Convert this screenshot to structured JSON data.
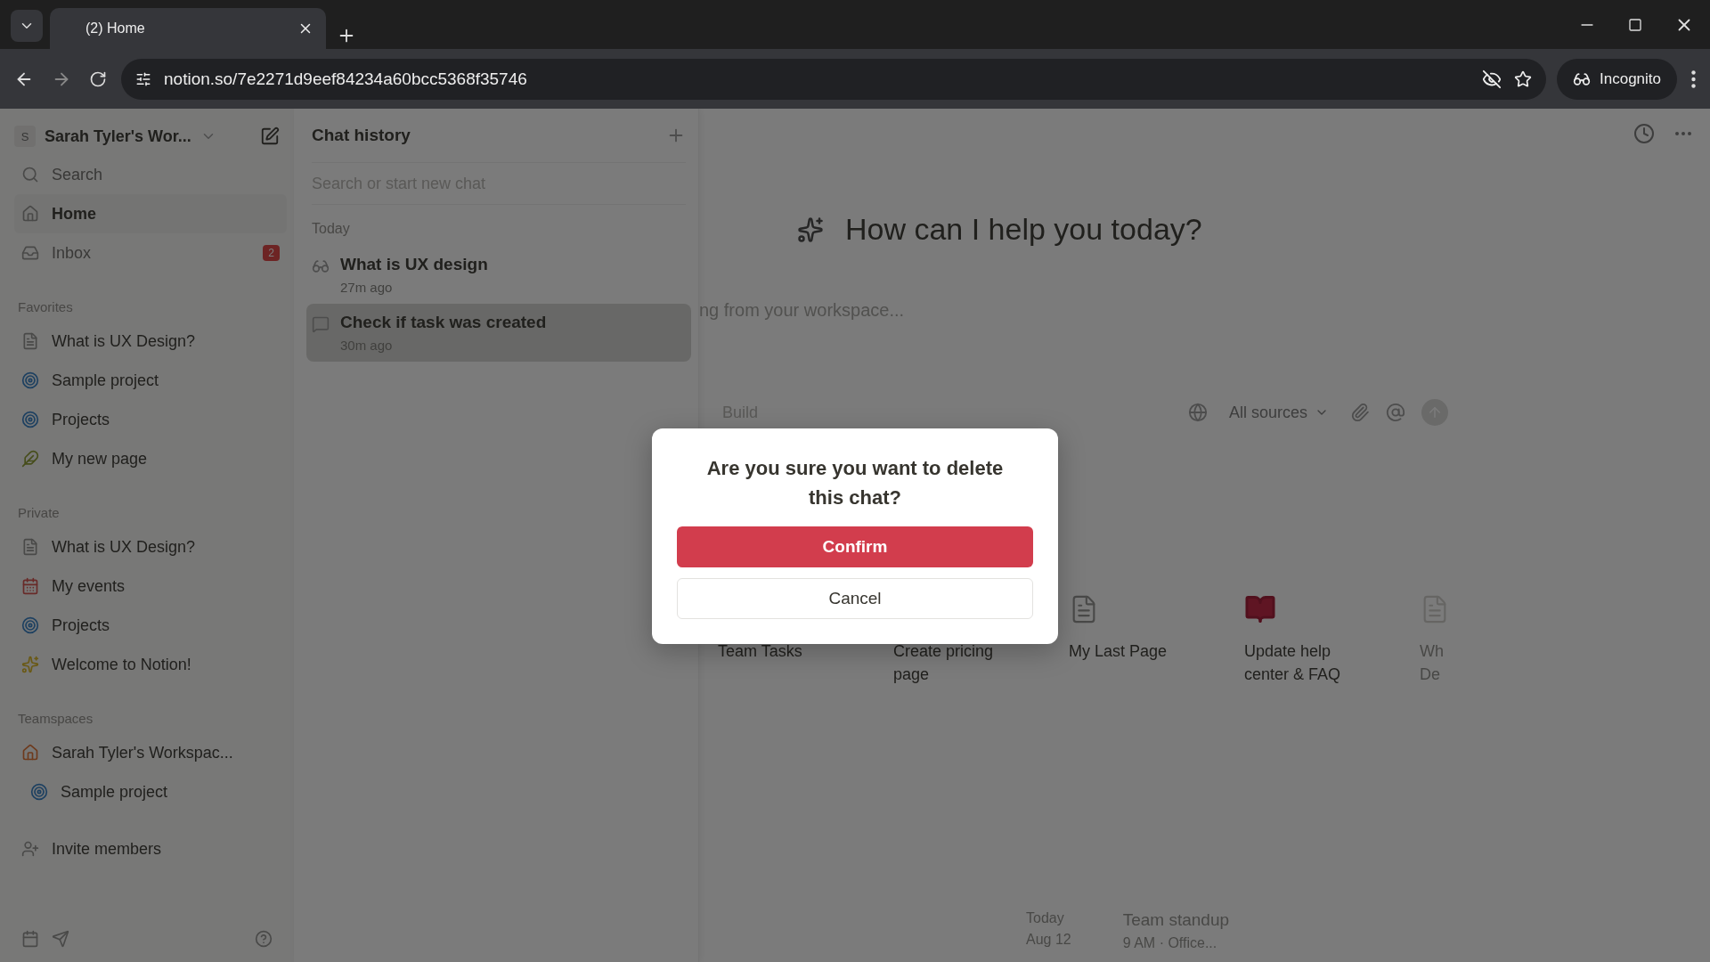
{
  "browser": {
    "tab_title": "(2) Home",
    "url": "notion.so/7e2271d9eef84234a60bcc5368f35746",
    "profile": "Incognito"
  },
  "sidebar": {
    "workspace": {
      "initial": "S",
      "name": "Sarah Tyler's Wor..."
    },
    "nav": [
      {
        "kind": "search",
        "label": "Search",
        "selected": false
      },
      {
        "kind": "home",
        "label": "Home",
        "selected": true
      },
      {
        "kind": "inbox",
        "label": "Inbox",
        "selected": false,
        "badge": "2"
      }
    ],
    "sections": [
      {
        "title": "Favorites",
        "items": [
          {
            "kind": "page",
            "label": "What is UX Design?"
          },
          {
            "kind": "project",
            "label": "Sample project"
          },
          {
            "kind": "project",
            "label": "Projects"
          },
          {
            "kind": "leaf",
            "label": "My new page"
          }
        ]
      },
      {
        "title": "Private",
        "items": [
          {
            "kind": "page",
            "label": "What is UX Design?"
          },
          {
            "kind": "calendar",
            "label": "My events"
          },
          {
            "kind": "project",
            "label": "Projects"
          },
          {
            "kind": "sparkle",
            "label": "Welcome to Notion!"
          }
        ]
      },
      {
        "title": "Teamspaces",
        "items": [
          {
            "kind": "house",
            "label": "Sarah Tyler's Workspac...",
            "children": [
              {
                "kind": "project",
                "label": "Sample project"
              }
            ]
          }
        ]
      }
    ],
    "invite": "Invite members"
  },
  "chat_history": {
    "title": "Chat history",
    "search_placeholder": "Search or start new chat",
    "group": "Today",
    "chats": [
      {
        "kind": "glasses",
        "title": "What is UX design",
        "time": "27m ago",
        "selected": false
      },
      {
        "kind": "chat",
        "title": "Check if task was created",
        "time": "30m ago",
        "selected": true
      }
    ]
  },
  "main": {
    "heading": "How can I help you today?",
    "input_placeholder": "ng from your workspace...",
    "mode": "Build",
    "sources": "All sources",
    "pages": [
      {
        "kind": "hidden",
        "title": "Team Tasks"
      },
      {
        "kind": "hidden",
        "title": "Create pricing page"
      },
      {
        "kind": "doc",
        "title": "My Last Page"
      },
      {
        "kind": "book",
        "title": "Update help center & FAQ"
      },
      {
        "kind": "doc-faded",
        "title": "Wh De"
      }
    ],
    "event": {
      "day": "Today",
      "date": "Aug 12",
      "title": "Team standup",
      "detail": "9 AM · Office..."
    }
  },
  "dialog": {
    "message": "Are you sure you want to delete this chat?",
    "confirm": "Confirm",
    "cancel": "Cancel"
  }
}
